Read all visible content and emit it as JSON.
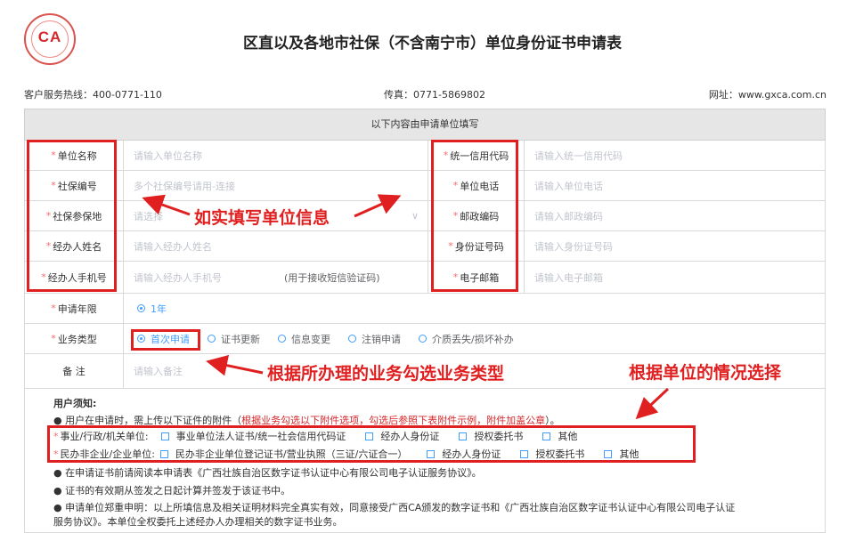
{
  "header": {
    "logo_text": "CA",
    "title": "区直以及各地市社保（不含南宁市）单位身份证书申请表",
    "hotline": "客户服务热线：400-0771-110",
    "fax": "传真：0771-5869802",
    "website": "网址：www.gxca.com.cn"
  },
  "section_header": "以下内容由申请单位填写",
  "form": {
    "rows": [
      {
        "left_label": "单位名称",
        "left_placeholder": "请输入单位名称",
        "right_label": "统一信用代码",
        "right_placeholder": "请输入统一信用代码"
      },
      {
        "left_label": "社保编号",
        "left_placeholder": "多个社保编号请用-连接",
        "right_label": "单位电话",
        "right_placeholder": "请输入单位电话"
      },
      {
        "left_label": "社保参保地",
        "left_placeholder": "请选择",
        "right_label": "邮政编码",
        "right_placeholder": "请输入邮政编码"
      },
      {
        "left_label": "经办人姓名",
        "left_placeholder": "请输入经办人姓名",
        "right_label": "身份证号码",
        "right_placeholder": "请输入身份证号码"
      },
      {
        "left_label": "经办人手机号",
        "left_placeholder": "请输入经办人手机号",
        "left_hint": "(用于接收短信验证码)",
        "right_label": "电子邮箱",
        "right_placeholder": "请输入电子邮箱"
      }
    ],
    "apply_years": {
      "label": "申请年限",
      "options": [
        "1年"
      ],
      "selected": "1年"
    },
    "business_type": {
      "label": "业务类型",
      "options": [
        "首次申请",
        "证书更新",
        "信息变更",
        "注销申请",
        "介质丢失/损坏补办"
      ],
      "selected": "首次申请"
    },
    "remark": {
      "label": "备 注",
      "placeholder": "请输入备注"
    }
  },
  "notice": {
    "title": "用户须知:",
    "line1_prefix": "用户在申请时，需上传以下证件的附件（",
    "line1_red": "根据业务勾选以下附件选项，勾选后参照下表附件示例，附件加盖公章",
    "line1_suffix": "）。",
    "gov_label": "事业/行政/机关单位:",
    "gov_options": [
      "事业单位法人证书/统一社会信用代码证",
      "经办人身份证",
      "授权委托书",
      "其他"
    ],
    "ent_label": "民办非企业/企业单位:",
    "ent_options": [
      "民办非企业单位登记证书/营业执照（三证/六证合一）",
      "经办人身份证",
      "授权委托书",
      "其他"
    ],
    "line4": "在申请证书前请阅读本申请表《广西壮族自治区数字证书认证中心有限公司电子认证服务协议》。",
    "line5": "证书的有效期从签发之日起计算并签发于该证书中。",
    "line6a": "申请单位郑重申明：以上所填信息及相关证明材料完全真实有效，同意接受广西CA颁发的数字证书和《广西壮族自治区数字证书认证中心有限公司电子认证",
    "line6b": "服务协议》。本单位全权委托上述经办人办理相关的数字证书业务。"
  },
  "annotations": {
    "fill_info": "如实填写单位信息",
    "select_business": "根据所办理的业务勾选业务类型",
    "select_by_unit": "根据单位的情况选择"
  },
  "colors": {
    "accent": "#409eff",
    "annotation": "#e02020",
    "required": "#f56c6c",
    "brand": "#d4282b"
  }
}
